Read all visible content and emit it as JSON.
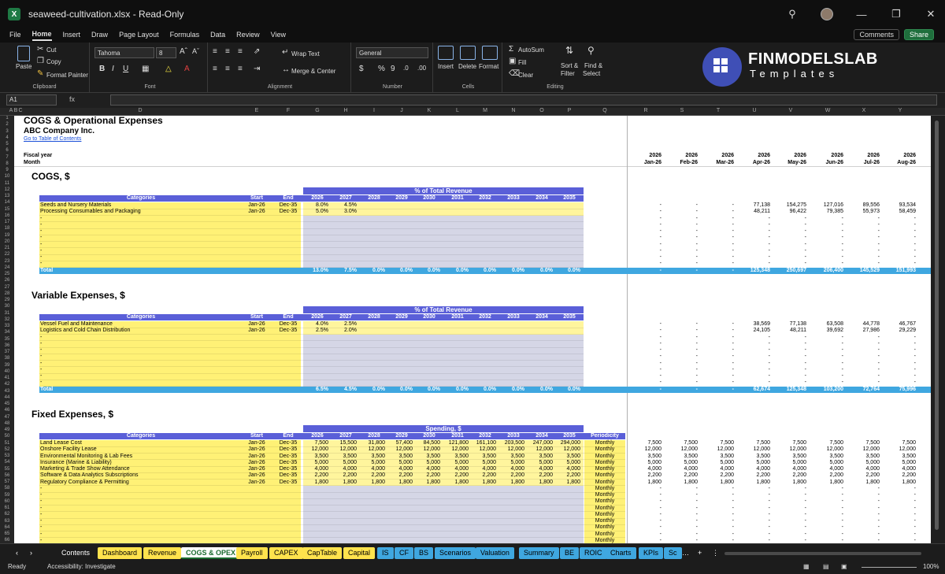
{
  "window": {
    "title": "seaweed-cultivation.xlsx - Read-Only"
  },
  "menu": {
    "tabs": [
      "File",
      "Home",
      "Insert",
      "Draw",
      "Page Layout",
      "Formulas",
      "Data",
      "Review",
      "View"
    ],
    "active": "Home",
    "comments": "Comments",
    "share": "Share"
  },
  "ribbon": {
    "clipboard": {
      "paste": "Paste",
      "cut": "Cut",
      "copy": "Copy",
      "format_painter": "Format Painter",
      "label": "Clipboard"
    },
    "font": {
      "name": "Tahoma",
      "size": "8",
      "label": "Font"
    },
    "alignment": {
      "wrap": "Wrap Text",
      "merge": "Merge & Center",
      "label": "Alignment"
    },
    "number": {
      "format": "General",
      "label": "Number"
    },
    "cells": {
      "insert": "Insert",
      "delete": "Delete",
      "format": "Format",
      "label": "Cells"
    },
    "editing": {
      "autosum": "AutoSum",
      "fill": "Fill",
      "clear": "Clear",
      "sort": "Sort &",
      "filter": "Filter",
      "find": "Find &",
      "select": "Select",
      "label": "Editing"
    }
  },
  "brand": {
    "name": "FINMODELSLAB",
    "sub": "Templates"
  },
  "formula_bar": {
    "name_box": "A1",
    "fx": "fx"
  },
  "columns": [
    "A",
    "B",
    "C",
    "D",
    "E",
    "F",
    "G",
    "H",
    "I",
    "J",
    "K",
    "L",
    "M",
    "N",
    "O",
    "P",
    "Q",
    "R",
    "S",
    "T",
    "U",
    "V",
    "W",
    "X",
    "Y"
  ],
  "sheet": {
    "title": "COGS & Operational Expenses",
    "company": "ABC Company Inc.",
    "toc_link": "Go to Table of Contents",
    "fiscal_year_label": "Fiscal year",
    "month_label": "Month",
    "timeline_years": [
      "2026",
      "2026",
      "2026",
      "2026",
      "2026",
      "2026",
      "2026",
      "2026"
    ],
    "timeline_months": [
      "Jan-26",
      "Feb-26",
      "Mar-26",
      "Apr-26",
      "May-26",
      "Jun-26",
      "Jul-26",
      "Aug-26"
    ],
    "headers": {
      "categories": "Categories",
      "start": "Start",
      "end": "End",
      "periodicity": "Periodicity"
    },
    "years": [
      "2026",
      "2027",
      "2028",
      "2029",
      "2030",
      "2031",
      "2032",
      "2033",
      "2034",
      "2035"
    ],
    "cogs": {
      "title": "COGS, $",
      "band": "% of Total Revenue",
      "rows": [
        {
          "name": "Seeds and Nursery Materials",
          "start": "Jan-26",
          "end": "Dec-35",
          "pct": [
            "8.0%",
            "4.5%"
          ],
          "months": [
            "-",
            "-",
            "-",
            "77,138",
            "154,275",
            "127,016",
            "89,556",
            "93,534"
          ]
        },
        {
          "name": "Processing Consumables and Packaging",
          "start": "Jan-26",
          "end": "Dec-35",
          "pct": [
            "5.0%",
            "3.0%"
          ],
          "months": [
            "-",
            "-",
            "-",
            "48,211",
            "96,422",
            "79,385",
            "55,973",
            "58,459"
          ]
        }
      ],
      "total_label": "Total",
      "total_pct": [
        "13.0%",
        "7.5%",
        "0.0%",
        "0.0%",
        "0.0%",
        "0.0%",
        "0.0%",
        "0.0%",
        "0.0%",
        "0.0%"
      ],
      "total_months": [
        "-",
        "-",
        "-",
        "125,348",
        "250,697",
        "206,400",
        "145,529",
        "151,993"
      ]
    },
    "variable": {
      "title": "Variable Expenses, $",
      "band": "% of Total Revenue",
      "rows": [
        {
          "name": "Vessel Fuel and Maintenance",
          "start": "Jan-26",
          "end": "Dec-35",
          "pct": [
            "4.0%",
            "2.5%"
          ],
          "months": [
            "-",
            "-",
            "-",
            "38,569",
            "77,138",
            "63,508",
            "44,778",
            "46,767"
          ]
        },
        {
          "name": "Logistics and Cold Chain Distribution",
          "start": "Jan-26",
          "end": "Dec-35",
          "pct": [
            "2.5%",
            "2.0%"
          ],
          "months": [
            "-",
            "-",
            "-",
            "24,105",
            "48,211",
            "39,692",
            "27,986",
            "29,229"
          ]
        }
      ],
      "total_label": "Total",
      "total_pct": [
        "6.5%",
        "4.5%",
        "0.0%",
        "0.0%",
        "0.0%",
        "0.0%",
        "0.0%",
        "0.0%",
        "0.0%",
        "0.0%"
      ],
      "total_months": [
        "-",
        "-",
        "-",
        "62,674",
        "125,348",
        "103,200",
        "72,764",
        "75,996"
      ]
    },
    "fixed": {
      "title": "Fixed Expenses, $",
      "band": "Spending, $",
      "rows": [
        {
          "name": "Land Lease Cost",
          "start": "Jan-26",
          "end": "Dec-35",
          "vals": [
            "7,500",
            "15,500",
            "31,800",
            "57,400",
            "84,500",
            "121,800",
            "161,100",
            "203,500",
            "247,000",
            "294,000"
          ],
          "per": "Monthly",
          "month": "7,500"
        },
        {
          "name": "Onshore Facility Lease",
          "start": "Jan-26",
          "end": "Dec-35",
          "vals": [
            "12,000",
            "12,000",
            "12,000",
            "12,000",
            "12,000",
            "12,000",
            "12,000",
            "12,000",
            "12,000",
            "12,000"
          ],
          "per": "Monthly",
          "month": "12,000"
        },
        {
          "name": "Environmental Monitoring & Lab Fees",
          "start": "Jan-26",
          "end": "Dec-35",
          "vals": [
            "3,500",
            "3,500",
            "3,500",
            "3,500",
            "3,500",
            "3,500",
            "3,500",
            "3,500",
            "3,500",
            "3,500"
          ],
          "per": "Monthly",
          "month": "3,500"
        },
        {
          "name": "Insurance (Marine & Liability)",
          "start": "Jan-26",
          "end": "Dec-35",
          "vals": [
            "5,000",
            "5,000",
            "5,000",
            "5,000",
            "5,000",
            "5,000",
            "5,000",
            "5,000",
            "5,000",
            "5,000"
          ],
          "per": "Monthly",
          "month": "5,000"
        },
        {
          "name": "Marketing & Trade Show Attendance",
          "start": "Jan-26",
          "end": "Dec-35",
          "vals": [
            "4,000",
            "4,000",
            "4,000",
            "4,000",
            "4,000",
            "4,000",
            "4,000",
            "4,000",
            "4,000",
            "4,000"
          ],
          "per": "Monthly",
          "month": "4,000"
        },
        {
          "name": "Software & Data Analytics Subscriptions",
          "start": "Jan-26",
          "end": "Dec-35",
          "vals": [
            "2,200",
            "2,200",
            "2,200",
            "2,200",
            "2,200",
            "2,200",
            "2,200",
            "2,200",
            "2,200",
            "2,200"
          ],
          "per": "Monthly",
          "month": "2,200"
        },
        {
          "name": "Regulatory Compliance & Permitting",
          "start": "Jan-26",
          "end": "Dec-35",
          "vals": [
            "1,800",
            "1,800",
            "1,800",
            "1,800",
            "1,800",
            "1,800",
            "1,800",
            "1,800",
            "1,800",
            "1,800"
          ],
          "per": "Monthly",
          "month": "1,800"
        }
      ],
      "empty_per": "Monthly"
    },
    "dash": "-"
  },
  "sheet_tabs": [
    {
      "label": "Contents",
      "style": "plain"
    },
    {
      "label": "Dashboard",
      "style": "yel"
    },
    {
      "label": "Revenue",
      "style": "yel"
    },
    {
      "label": "COGS & OPEX",
      "style": "active"
    },
    {
      "label": "Payroll",
      "style": "yel"
    },
    {
      "label": "CAPEX",
      "style": "yel"
    },
    {
      "label": "CapTable",
      "style": "yel"
    },
    {
      "label": "Capital",
      "style": "yel"
    },
    {
      "label": "IS",
      "style": "blu"
    },
    {
      "label": "CF",
      "style": "blu"
    },
    {
      "label": "BS",
      "style": "blu"
    },
    {
      "label": "Scenarios",
      "style": "blu"
    },
    {
      "label": "Valuation",
      "style": "blu"
    },
    {
      "label": "Summary",
      "style": "blu"
    },
    {
      "label": "BE",
      "style": "blu"
    },
    {
      "label": "ROIC",
      "style": "blu"
    },
    {
      "label": "Charts",
      "style": "blu"
    },
    {
      "label": "KPIs",
      "style": "blu"
    },
    {
      "label": "Sc",
      "style": "blu"
    }
  ],
  "status": {
    "ready": "Ready",
    "accessibility": "Accessibility: Investigate",
    "zoom": "100%"
  }
}
